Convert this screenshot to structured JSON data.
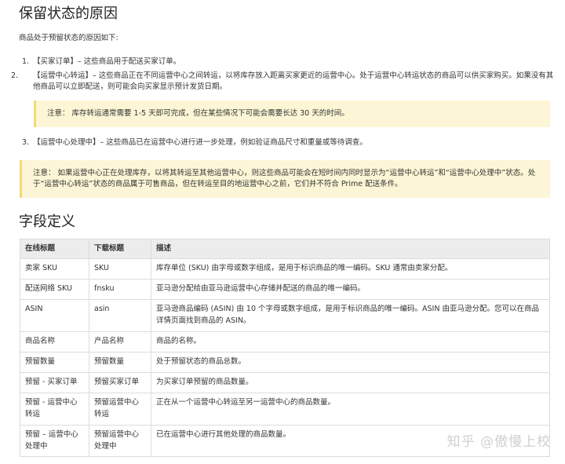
{
  "sections": {
    "title1": "保留状态的原因",
    "intro": "商品处于预留状态的原因如下:",
    "items": [
      {
        "num": "1.",
        "text": "【买家订单】– 这些商品用于配送买家订单。"
      },
      {
        "num": "2.",
        "text": "【运营中心转运】– 这些商品正在不同运营中心之间转运，以将库存放入距离买家更近的运营中心。处于运营中心转运状态的商品可以供买家购买。如果没有其他商品可以立即配送，则可能会向买家显示预计发货日期。"
      },
      {
        "num": "3.",
        "text": "【运营中心处理中】– 这些商品已在运营中心进行进一步处理，例如验证商品尺寸和重量或等待调查。"
      }
    ],
    "note1": "注意： 库存转运通常需要 1-5 天即可完成，但在某些情况下可能会需要长达 30 天的时间。",
    "note2": "注意： 如果运营中心正在处理库存，以将其转运至其他运营中心，则这些商品可能会在短时间内同时显示为“运营中心转运”和“运营中心处理中”状态。处于“运营中心转运”状态的商品属于可售商品，但在转运至目的地运营中心之前，它们并不符合 Prime 配送条件。",
    "title2": "字段定义"
  },
  "table": {
    "headers": [
      "在线标题",
      "下载标题",
      "描述"
    ],
    "rows": [
      [
        "卖家 SKU",
        "SKU",
        "库存单位 (SKU) 由字母或数字组成，是用于标识商品的唯一编码。SKU 通常由卖家分配。"
      ],
      [
        "配送网络 SKU",
        "fnsku",
        "亚马逊分配给由亚马逊运营中心存储并配送的商品的唯一编码。"
      ],
      [
        "ASIN",
        "asin",
        "亚马逊商品编码 (ASIN) 由 10 个字母或数字组成，是用于标识商品的唯一编码。ASIN 由亚马逊分配。您可以在商品详情页面找到商品的 ASIN。"
      ],
      [
        "商品名称",
        "产品名称",
        "商品的名称。"
      ],
      [
        "预留数量",
        "预留数量",
        "处于预留状态的商品总数。"
      ],
      [
        "预留 - 买家订单",
        "预留买家订单",
        "为买家订单预留的商品数量。"
      ],
      [
        "预留 - 运营中心转运",
        "预留运营中心转运",
        "正在从一个运营中心转运至另一运营中心的商品数量。"
      ],
      [
        "预留 – 运营中心处理中",
        "预留运营中心处理中",
        "已在运营中心进行其他处理的商品数量。"
      ]
    ]
  },
  "watermark": "知乎 @傲慢上校"
}
